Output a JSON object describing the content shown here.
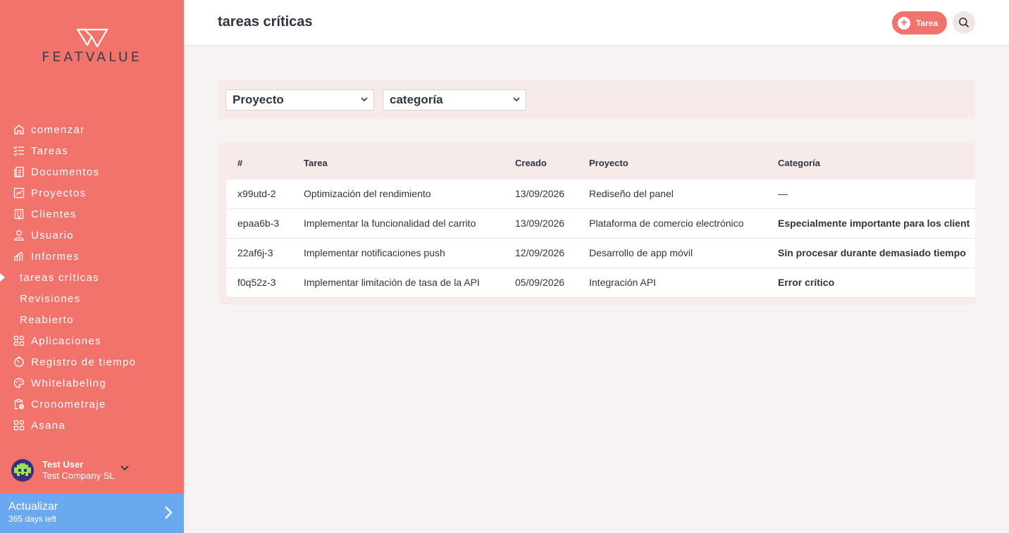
{
  "brand": {
    "name": "FEATVALUE",
    "accent": "#f2736b",
    "upgrade_color": "#6aa9f0"
  },
  "sidebar": {
    "items": [
      {
        "label": "comenzar",
        "icon": "home-icon"
      },
      {
        "label": "Tareas",
        "icon": "checklist-icon"
      },
      {
        "label": "Documentos",
        "icon": "documents-icon"
      },
      {
        "label": "Proyectos",
        "icon": "chart-icon"
      },
      {
        "label": "Clientes",
        "icon": "building-icon"
      },
      {
        "label": "Usuario",
        "icon": "user-icon"
      },
      {
        "label": "Informes",
        "icon": "bar-chart-icon"
      },
      {
        "label": "tareas críticas",
        "sub": true,
        "active": true
      },
      {
        "label": "Revisiones",
        "sub": true
      },
      {
        "label": "Reabierto",
        "sub": true
      },
      {
        "label": "Aplicaciones",
        "icon": "apps-icon"
      },
      {
        "label": "Registro de tiempo",
        "icon": "timer-icon"
      },
      {
        "label": "Whitelabeling",
        "icon": "palette-icon"
      },
      {
        "label": "Cronometraje",
        "icon": "clipboard-clock-icon"
      },
      {
        "label": "Asana",
        "icon": "apps-icon"
      }
    ]
  },
  "user": {
    "name": "Test User",
    "company": "Test Company SL"
  },
  "upgrade": {
    "title": "Actualizar",
    "subtitle": "365 days left"
  },
  "header": {
    "title": "tareas críticas",
    "add_task_label": "Tarea"
  },
  "filters": {
    "project": "Proyecto",
    "category": "categoría"
  },
  "table": {
    "headers": {
      "id": "#",
      "task": "Tarea",
      "created": "Creado",
      "project": "Proyecto",
      "category": "Categoría"
    },
    "rows": [
      {
        "id": "x99utd-2",
        "task": "Optimización del rendimiento",
        "created": "13/09/2026",
        "project": "Rediseño del panel",
        "category": "—"
      },
      {
        "id": "epaa6b-3",
        "task": "Implementar la funcionalidad del carrito",
        "created": "13/09/2026",
        "project": "Plataforma de comercio electrónico",
        "category": "Especialmente importante para los client"
      },
      {
        "id": "22af6j-3",
        "task": "Implementar notificaciones push",
        "created": "12/09/2026",
        "project": "Desarrollo de app móvil",
        "category": "Sin procesar durante demasiado tiempo"
      },
      {
        "id": "f0q52z-3",
        "task": "Implementar limitación de tasa de la API",
        "created": "05/09/2026",
        "project": "Integración API",
        "category": "Error crítico"
      }
    ]
  }
}
